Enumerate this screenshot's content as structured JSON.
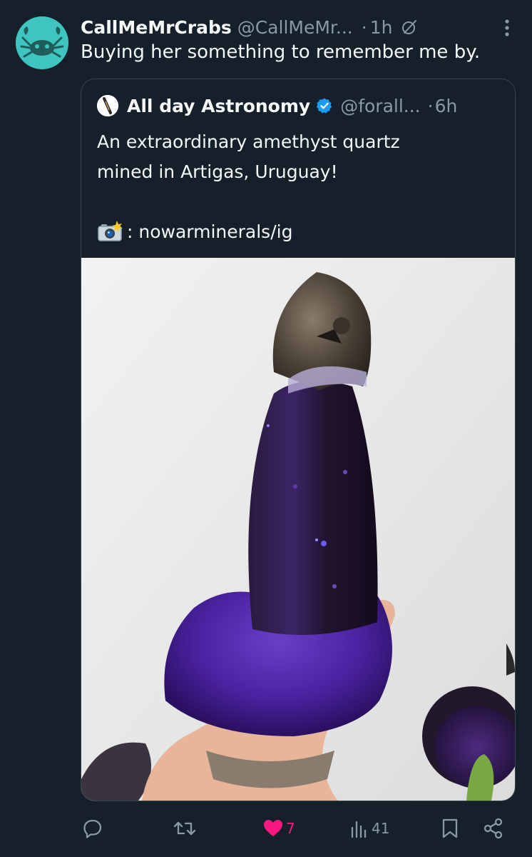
{
  "tweet": {
    "author_name": "CallMeMrCrabs",
    "author_handle": "@CallMeMr...",
    "separator": "·",
    "time": "1h",
    "text": "Buying her something to remember me by."
  },
  "quoted_tweet": {
    "author_name": "All day Astronomy",
    "author_handle": "@forall...",
    "separator": "·",
    "time": "6h",
    "text_line_1": "An extraordinary amethyst quartz",
    "text_line_2": "mined in Artigas, Uruguay!",
    "credit": ": nowarminerals/ig"
  },
  "actions": {
    "likes": "7",
    "views": "41"
  },
  "colors": {
    "background": "#15202b",
    "text": "#f7f9f9",
    "muted": "#8b98a5",
    "border": "#38444d",
    "like": "#f91880",
    "verified": "#1d9bf0",
    "avatar": "#3fc5bf"
  },
  "icons": {
    "reply": "speech-bubble",
    "retweet": "retweet-arrows",
    "like": "heart-filled",
    "views": "bar-chart",
    "bookmark": "bookmark",
    "share": "share-nodes"
  }
}
